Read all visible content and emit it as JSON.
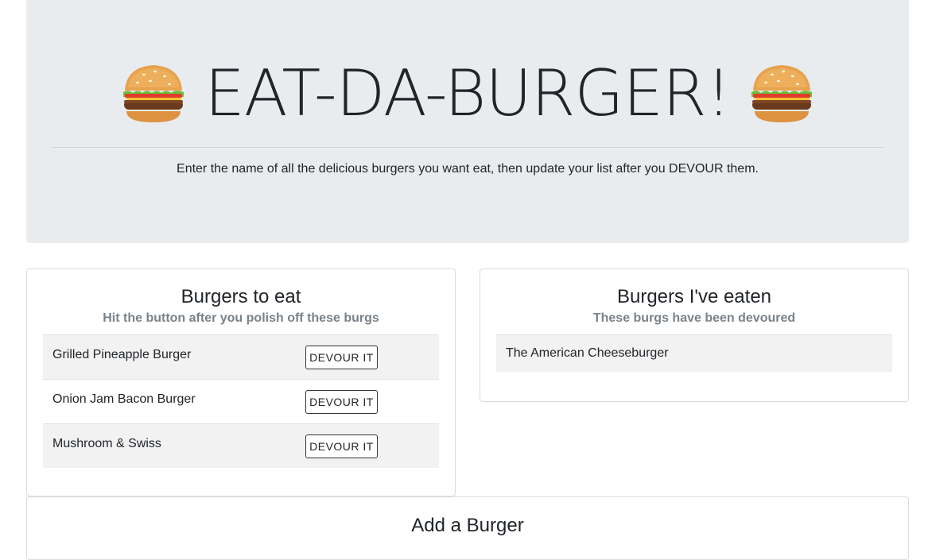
{
  "header": {
    "title": "EAT-DA-BURGER!",
    "subtitle": "Enter the name of all the delicious burgers you want eat, then update your list after you DEVOUR them."
  },
  "to_eat": {
    "title": "Burgers to eat",
    "subtitle": "Hit the button after you polish off these burgs",
    "button_label": "DEVOUR IT",
    "items": [
      {
        "name": "Grilled Pineapple Burger"
      },
      {
        "name": "Onion Jam Bacon Burger"
      },
      {
        "name": "Mushroom & Swiss"
      }
    ]
  },
  "eaten": {
    "title": "Burgers I've eaten",
    "subtitle": "These burgs have been devoured",
    "items": [
      {
        "name": "The American Cheeseburger"
      }
    ]
  },
  "add": {
    "title": "Add a Burger"
  },
  "icons": {
    "header_left": "burger-icon",
    "header_right": "burger-icon"
  }
}
